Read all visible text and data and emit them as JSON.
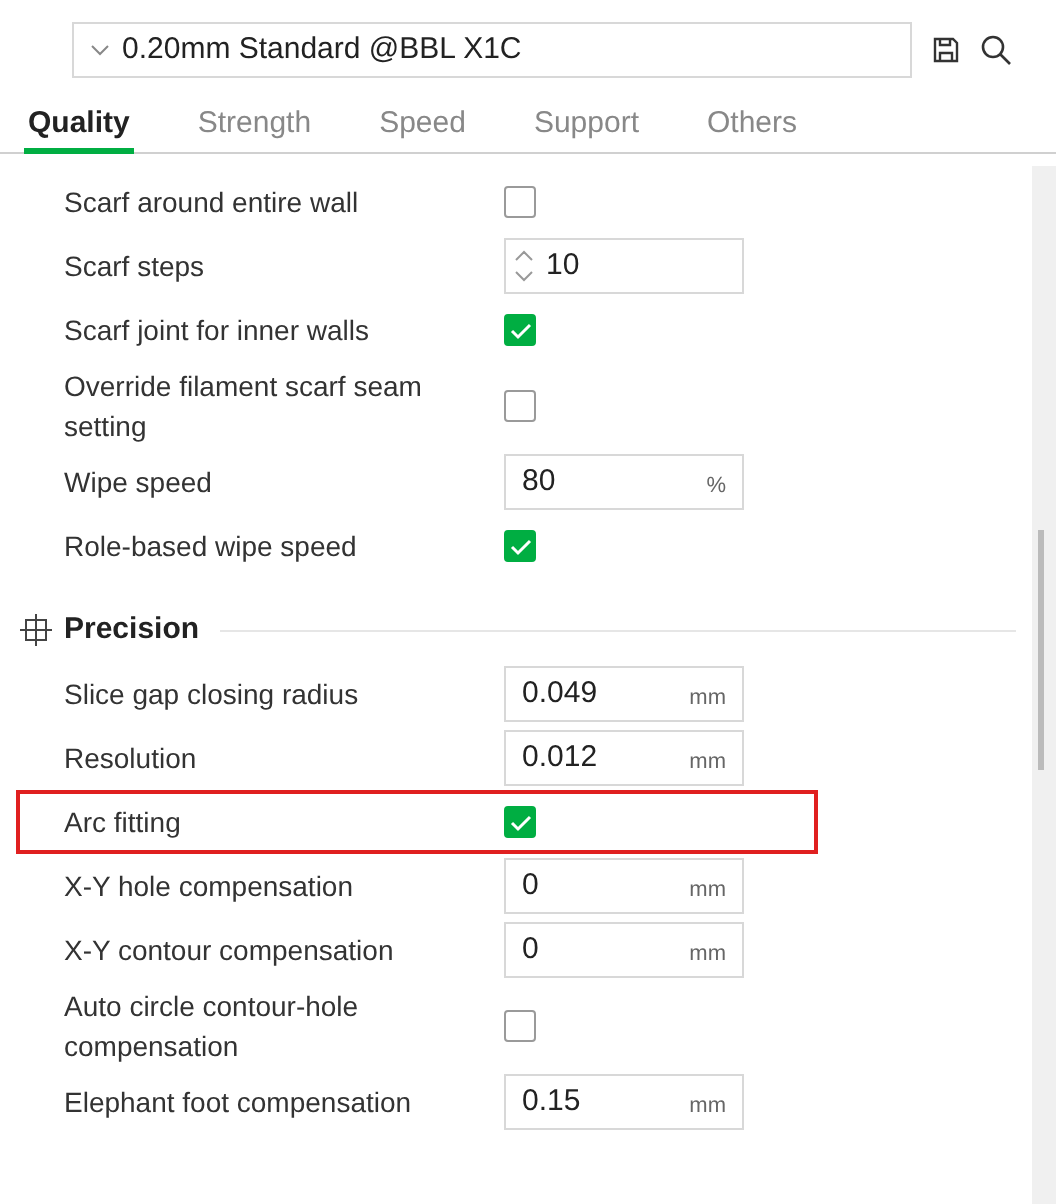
{
  "preset": {
    "value": "0.20mm Standard @BBL X1C"
  },
  "tabs": [
    {
      "label": "Quality",
      "selected": true
    },
    {
      "label": "Strength",
      "selected": false
    },
    {
      "label": "Speed",
      "selected": false
    },
    {
      "label": "Support",
      "selected": false
    },
    {
      "label": "Others",
      "selected": false
    }
  ],
  "rows": [
    {
      "kind": "checkbox",
      "label": "Scarf around entire wall",
      "checked": false,
      "highlighted": false
    },
    {
      "kind": "spin",
      "label": "Scarf steps",
      "value": "10",
      "highlighted": false
    },
    {
      "kind": "checkbox",
      "label": "Scarf joint for inner walls",
      "checked": true,
      "highlighted": false
    },
    {
      "kind": "checkbox",
      "label": "Override filament scarf seam setting",
      "checked": false,
      "highlighted": false
    },
    {
      "kind": "input",
      "label": "Wipe speed",
      "value": "80",
      "unit": "%",
      "highlighted": false
    },
    {
      "kind": "checkbox",
      "label": "Role-based wipe speed",
      "checked": true,
      "highlighted": false
    },
    {
      "kind": "header",
      "label": "Precision"
    },
    {
      "kind": "input",
      "label": "Slice gap closing radius",
      "value": "0.049",
      "unit": "mm",
      "highlighted": false
    },
    {
      "kind": "input",
      "label": "Resolution",
      "value": "0.012",
      "unit": "mm",
      "highlighted": false
    },
    {
      "kind": "checkbox",
      "label": "Arc fitting",
      "checked": true,
      "highlighted": true
    },
    {
      "kind": "input",
      "label": "X-Y hole compensation",
      "value": "0",
      "unit": "mm",
      "highlighted": false
    },
    {
      "kind": "input",
      "label": "X-Y contour compensation",
      "value": "0",
      "unit": "mm",
      "highlighted": false
    },
    {
      "kind": "checkbox",
      "label": "Auto circle contour-hole compensation",
      "checked": false,
      "highlighted": false
    },
    {
      "kind": "input",
      "label": "Elephant foot compensation",
      "value": "0.15",
      "unit": "mm",
      "highlighted": false
    }
  ]
}
